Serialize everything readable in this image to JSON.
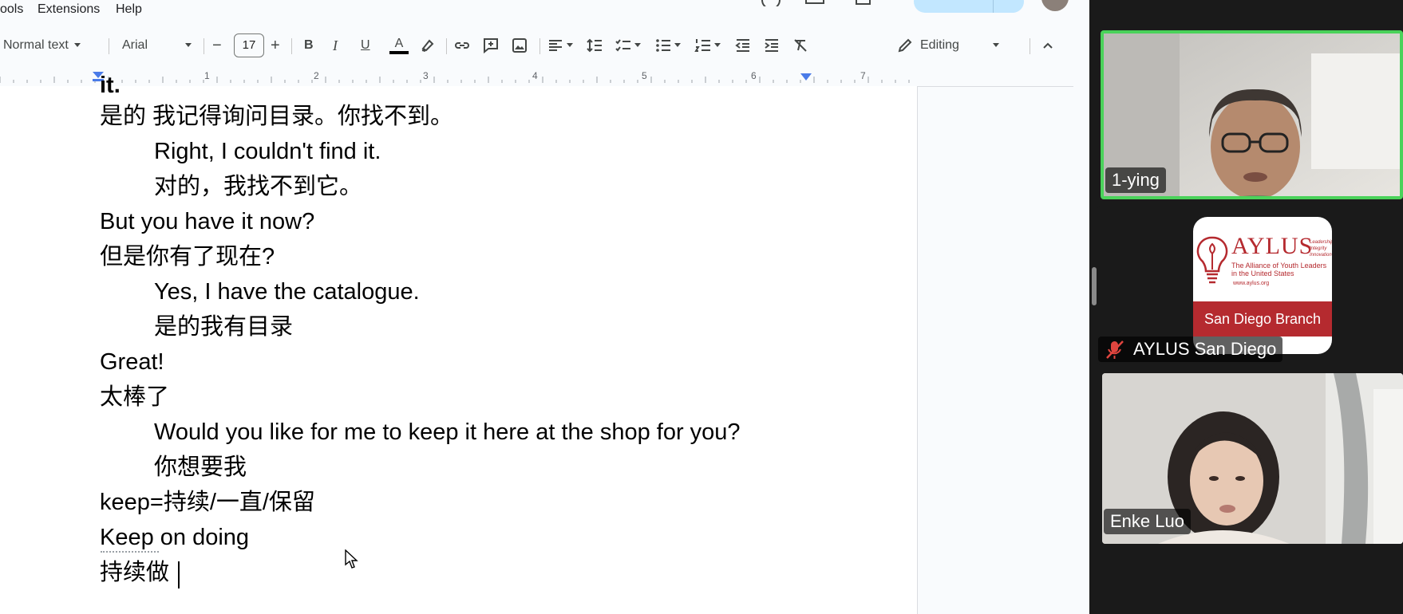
{
  "menu": {
    "tools": "ools",
    "extensions": "Extensions",
    "help": "Help"
  },
  "toolbar": {
    "style": "Normal text",
    "font": "Arial",
    "font_size": "17",
    "minus": "−",
    "plus": "+",
    "bold": "B",
    "italic": "I",
    "underline": "U",
    "text_color_letter": "A",
    "mode": "Editing"
  },
  "ruler": {
    "numbers": [
      "1",
      "2",
      "3",
      "4",
      "5",
      "6",
      "7"
    ]
  },
  "document": {
    "lines": [
      "it.",
      "是的 我记得询问目录。你找不到。",
      "Right, I couldn't find it.",
      "对的，我找不到它。",
      "But you have it now?",
      "但是你有了现在?",
      "Yes, I have the catalogue.",
      "是的我有目录",
      "Great!",
      "太棒了",
      "Would you like for me to keep it here at the shop for you?",
      "你想要我",
      "keep=持续/一直/保留",
      "Keep on doing",
      "持续做"
    ]
  },
  "participants": [
    {
      "name": "1-ying"
    },
    {
      "name": "AYLUS San Diego"
    },
    {
      "name": "Enke Luo"
    }
  ],
  "aylus_logo": {
    "wordmark": "AYLUS",
    "taglines": [
      "Leadership",
      "Integrity",
      "Innovation"
    ],
    "full_name_1": "The Alliance of Youth Leaders",
    "full_name_2": "in the United States",
    "site": "www.aylus.org",
    "branch": "San Diego Branch"
  },
  "colors": {
    "speaker_border": "#4ad25a",
    "aylus_red": "#b52a2f",
    "doc_bg": "#f9fbfd"
  }
}
